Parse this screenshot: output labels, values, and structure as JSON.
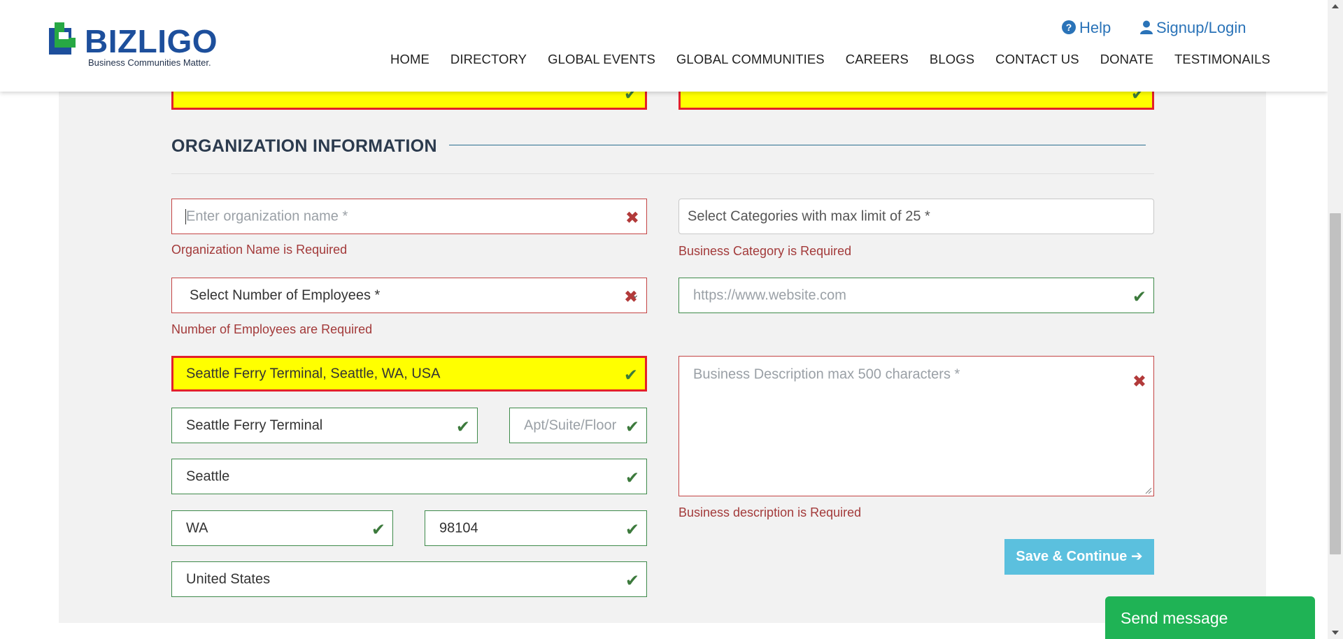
{
  "brand": {
    "name": "BIZLIGO",
    "tagline": "Business Communities Matter.",
    "colors": {
      "primary": "#1d4f9c",
      "accent": "#27a844"
    }
  },
  "toplinks": {
    "help": {
      "icon": "question-circle-icon",
      "label": "Help"
    },
    "signup": {
      "icon": "user-icon",
      "label": "Signup/Login"
    }
  },
  "nav": {
    "items": [
      {
        "label": "HOME"
      },
      {
        "label": "DIRECTORY"
      },
      {
        "label": "GLOBAL EVENTS"
      },
      {
        "label": "GLOBAL COMMUNITIES"
      },
      {
        "label": "CAREERS"
      },
      {
        "label": "BLOGS"
      },
      {
        "label": "CONTACT US"
      },
      {
        "label": "DONATE"
      },
      {
        "label": "TESTIMONAILS"
      }
    ]
  },
  "password": {
    "masked": "••••••••••",
    "confirm_masked": "••••••••••"
  },
  "section": {
    "title": "ORGANIZATION INFORMATION"
  },
  "form": {
    "org_name": {
      "placeholder": "Enter organization name *",
      "value": "",
      "status": "invalid",
      "error": "Organization Name is Required"
    },
    "categories": {
      "placeholder": "Select Categories with max limit of 25 *",
      "error": "Business Category is Required"
    },
    "employees": {
      "selected": "Select Number of Employees *",
      "status": "invalid",
      "error": "Number of Employees are Required"
    },
    "website": {
      "placeholder": "https://www.website.com",
      "value": "",
      "status": "valid"
    },
    "location": {
      "value": "Seattle Ferry Terminal, Seattle, WA, USA",
      "status": "valid"
    },
    "street": {
      "value": "Seattle Ferry Terminal",
      "status": "valid"
    },
    "apt": {
      "placeholder": "Apt/Suite/Floor",
      "value": "",
      "status": "valid"
    },
    "city": {
      "value": "Seattle",
      "status": "valid"
    },
    "state": {
      "value": "WA",
      "status": "valid"
    },
    "zip": {
      "value": "98104",
      "status": "valid"
    },
    "country": {
      "value": "United States",
      "status": "valid"
    },
    "description": {
      "placeholder": "Business Description max 500 characters *",
      "value": "",
      "status": "invalid",
      "error": "Business description is Required"
    },
    "status_icons": {
      "valid": "✔",
      "invalid": "✖"
    }
  },
  "actions": {
    "save": "Save & Continue ➔",
    "send_message": "Send message"
  }
}
